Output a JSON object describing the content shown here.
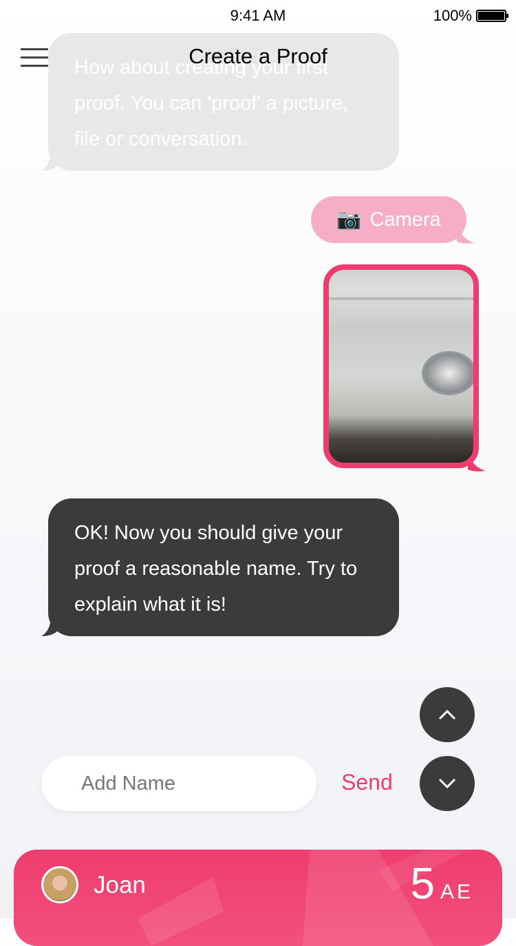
{
  "status_bar": {
    "time": "9:41 AM",
    "battery": "100%"
  },
  "header": {
    "title": "Create a Proof",
    "menu_icon": "hamburger-icon"
  },
  "messages": [
    {
      "from": "bot",
      "text": "How about creating your first proof. You can 'proof' a picture, file or conversation."
    },
    {
      "from": "user",
      "icon": "camera-icon",
      "text": "Camera"
    },
    {
      "from": "user",
      "type": "photo"
    },
    {
      "from": "bot",
      "text": "OK! Now you should give your proof a reasonable name. Try to explain what it is!"
    }
  ],
  "composer": {
    "placeholder": "Add Name",
    "value": "",
    "send_label": "Send"
  },
  "user_card": {
    "name": "Joan",
    "score": "5",
    "unit": "AE"
  },
  "colors": {
    "accent": "#ee3c6e",
    "bot_bubble": "#3b3b3b",
    "pink_bubble": "#f6aec6"
  }
}
